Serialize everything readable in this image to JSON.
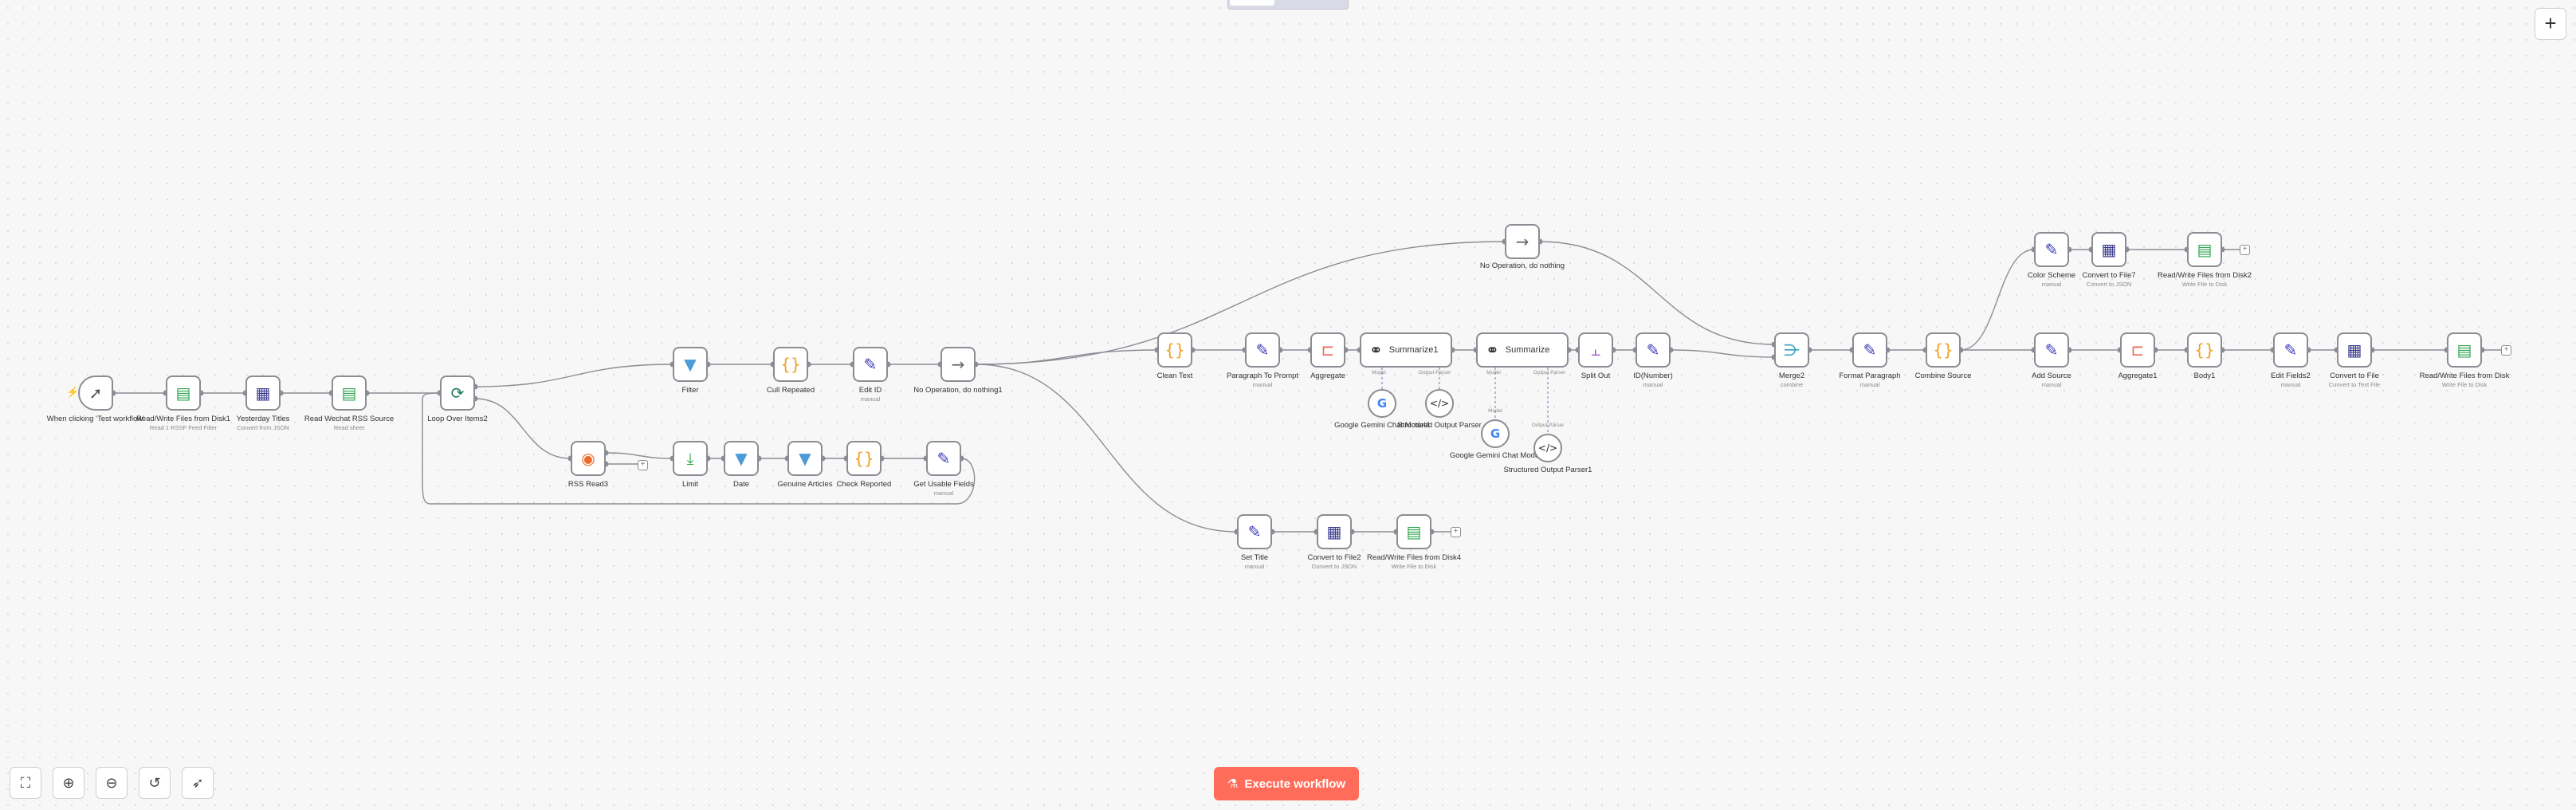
{
  "colors": {
    "accent": "#ff6d5a",
    "canvas_bg": "#f7f7f8",
    "edge": "#8c8c94",
    "ai_edge": "#8a8cc4"
  },
  "toolbar": {
    "add_node_icon": "plus-icon",
    "execute_label": "Execute workflow",
    "execute_icon": "flask-icon",
    "zoom_to_fit_icon": "fullscreen-icon",
    "zoom_in_icon": "zoom-in-icon",
    "zoom_out_icon": "zoom-out-icon",
    "reset_icon": "undo-icon",
    "tidy_icon": "cursor-sparkle-icon"
  },
  "nodes": {
    "trigger": {
      "label": "When clicking ‘Test workflow’",
      "icon": "cursor-icon"
    },
    "readfiles1": {
      "label": "Read/Write Files from Disk1",
      "sub": "Read 1 RSSF Feed Filter",
      "icon": "file-sheet-icon"
    },
    "yesterday": {
      "label": "Yesterday Titles",
      "sub": "Convert from JSON",
      "icon": "file-convert-icon"
    },
    "readwechat": {
      "label": "Read Wechat RSS Source",
      "sub": "Read sheet",
      "icon": "sheet-icon"
    },
    "loop": {
      "label": "Loop Over Items2",
      "icon": "loop-icon"
    },
    "filter": {
      "label": "Filter",
      "icon": "filter-icon"
    },
    "cullrep": {
      "label": "Cull Repeated",
      "icon": "code-braces-icon"
    },
    "editid": {
      "label": "Edit ID",
      "sub": "manual",
      "icon": "pencil-icon"
    },
    "noop1": {
      "label": "No Operation, do nothing1",
      "icon": "arrow-right-icon"
    },
    "rssread": {
      "label": "RSS Read3",
      "icon": "rss-icon"
    },
    "limit": {
      "label": "Limit",
      "icon": "limit-icon"
    },
    "date": {
      "label": "Date",
      "icon": "filter-icon"
    },
    "genuine": {
      "label": "Genuine Articles",
      "icon": "filter-icon"
    },
    "checkrep": {
      "label": "Check Reported",
      "icon": "code-braces-icon"
    },
    "getusable": {
      "label": "Get Usable Fields",
      "sub": "manual",
      "icon": "pencil-icon"
    },
    "noop": {
      "label": "No Operation, do nothing",
      "icon": "arrow-right-icon"
    },
    "cleantext": {
      "label": "Clean Text",
      "icon": "code-braces-icon"
    },
    "paraprompt": {
      "label": "Paragraph To Prompt",
      "sub": "manual",
      "icon": "pencil-icon"
    },
    "aggregate": {
      "label": "Aggregate",
      "icon": "aggregate-icon"
    },
    "summarize1": {
      "label": "Summarize1",
      "icon": "link-chain-icon"
    },
    "summarize": {
      "label": "Summarize",
      "icon": "link-chain-icon"
    },
    "geminiA": {
      "label": "Google Gemini Chat Model4",
      "icon": "google-icon"
    },
    "structA": {
      "label": "Structured Output Parser",
      "icon": "code-tag-icon"
    },
    "geminiB": {
      "label": "Google Gemini Chat Model",
      "icon": "google-icon"
    },
    "structB": {
      "label": "Structured Output Parser1",
      "icon": "code-tag-icon"
    },
    "splitout": {
      "label": "Split Out",
      "icon": "split-icon"
    },
    "idnumber": {
      "label": "ID(Number)",
      "sub": "manual",
      "icon": "pencil-icon"
    },
    "settitle": {
      "label": "Set Title",
      "sub": "manual",
      "icon": "pencil-icon"
    },
    "convfile2": {
      "label": "Convert to File2",
      "sub": "Convert to JSON",
      "icon": "file-convert-icon"
    },
    "readfiles4": {
      "label": "Read/Write Files from Disk4",
      "sub": "Write File to Disk",
      "icon": "file-sheet-icon"
    },
    "merge2": {
      "label": "Merge2",
      "sub": "combine",
      "icon": "merge-icon"
    },
    "formatpara": {
      "label": "Format Paragraph",
      "sub": "manual",
      "icon": "pencil-icon"
    },
    "combinesrc": {
      "label": "Combine Source",
      "icon": "code-braces-icon"
    },
    "colorscheme": {
      "label": "Color Scheme",
      "sub": "manual",
      "icon": "pencil-icon"
    },
    "convfile7": {
      "label": "Convert to File7",
      "sub": "Convert to JSON",
      "icon": "file-convert-icon"
    },
    "readfiles2": {
      "label": "Read/Write Files from Disk2",
      "sub": "Write File to Disk",
      "icon": "file-sheet-icon"
    },
    "addsource": {
      "label": "Add Source",
      "sub": "manual",
      "icon": "pencil-icon"
    },
    "aggregate1": {
      "label": "Aggregate1",
      "icon": "aggregate-icon"
    },
    "body1": {
      "label": "Body1",
      "icon": "code-braces-icon"
    },
    "editfields2": {
      "label": "Edit Fields2",
      "sub": "manual",
      "icon": "pencil-icon"
    },
    "convfile": {
      "label": "Convert to File",
      "sub": "Convert to Text File",
      "icon": "file-convert-icon"
    },
    "readfiles": {
      "label": "Read/Write Files from Disk",
      "sub": "Write File to Disk",
      "icon": "file-sheet-icon"
    }
  },
  "subports": {
    "model": "Model",
    "output_parser": "Output Parser"
  }
}
